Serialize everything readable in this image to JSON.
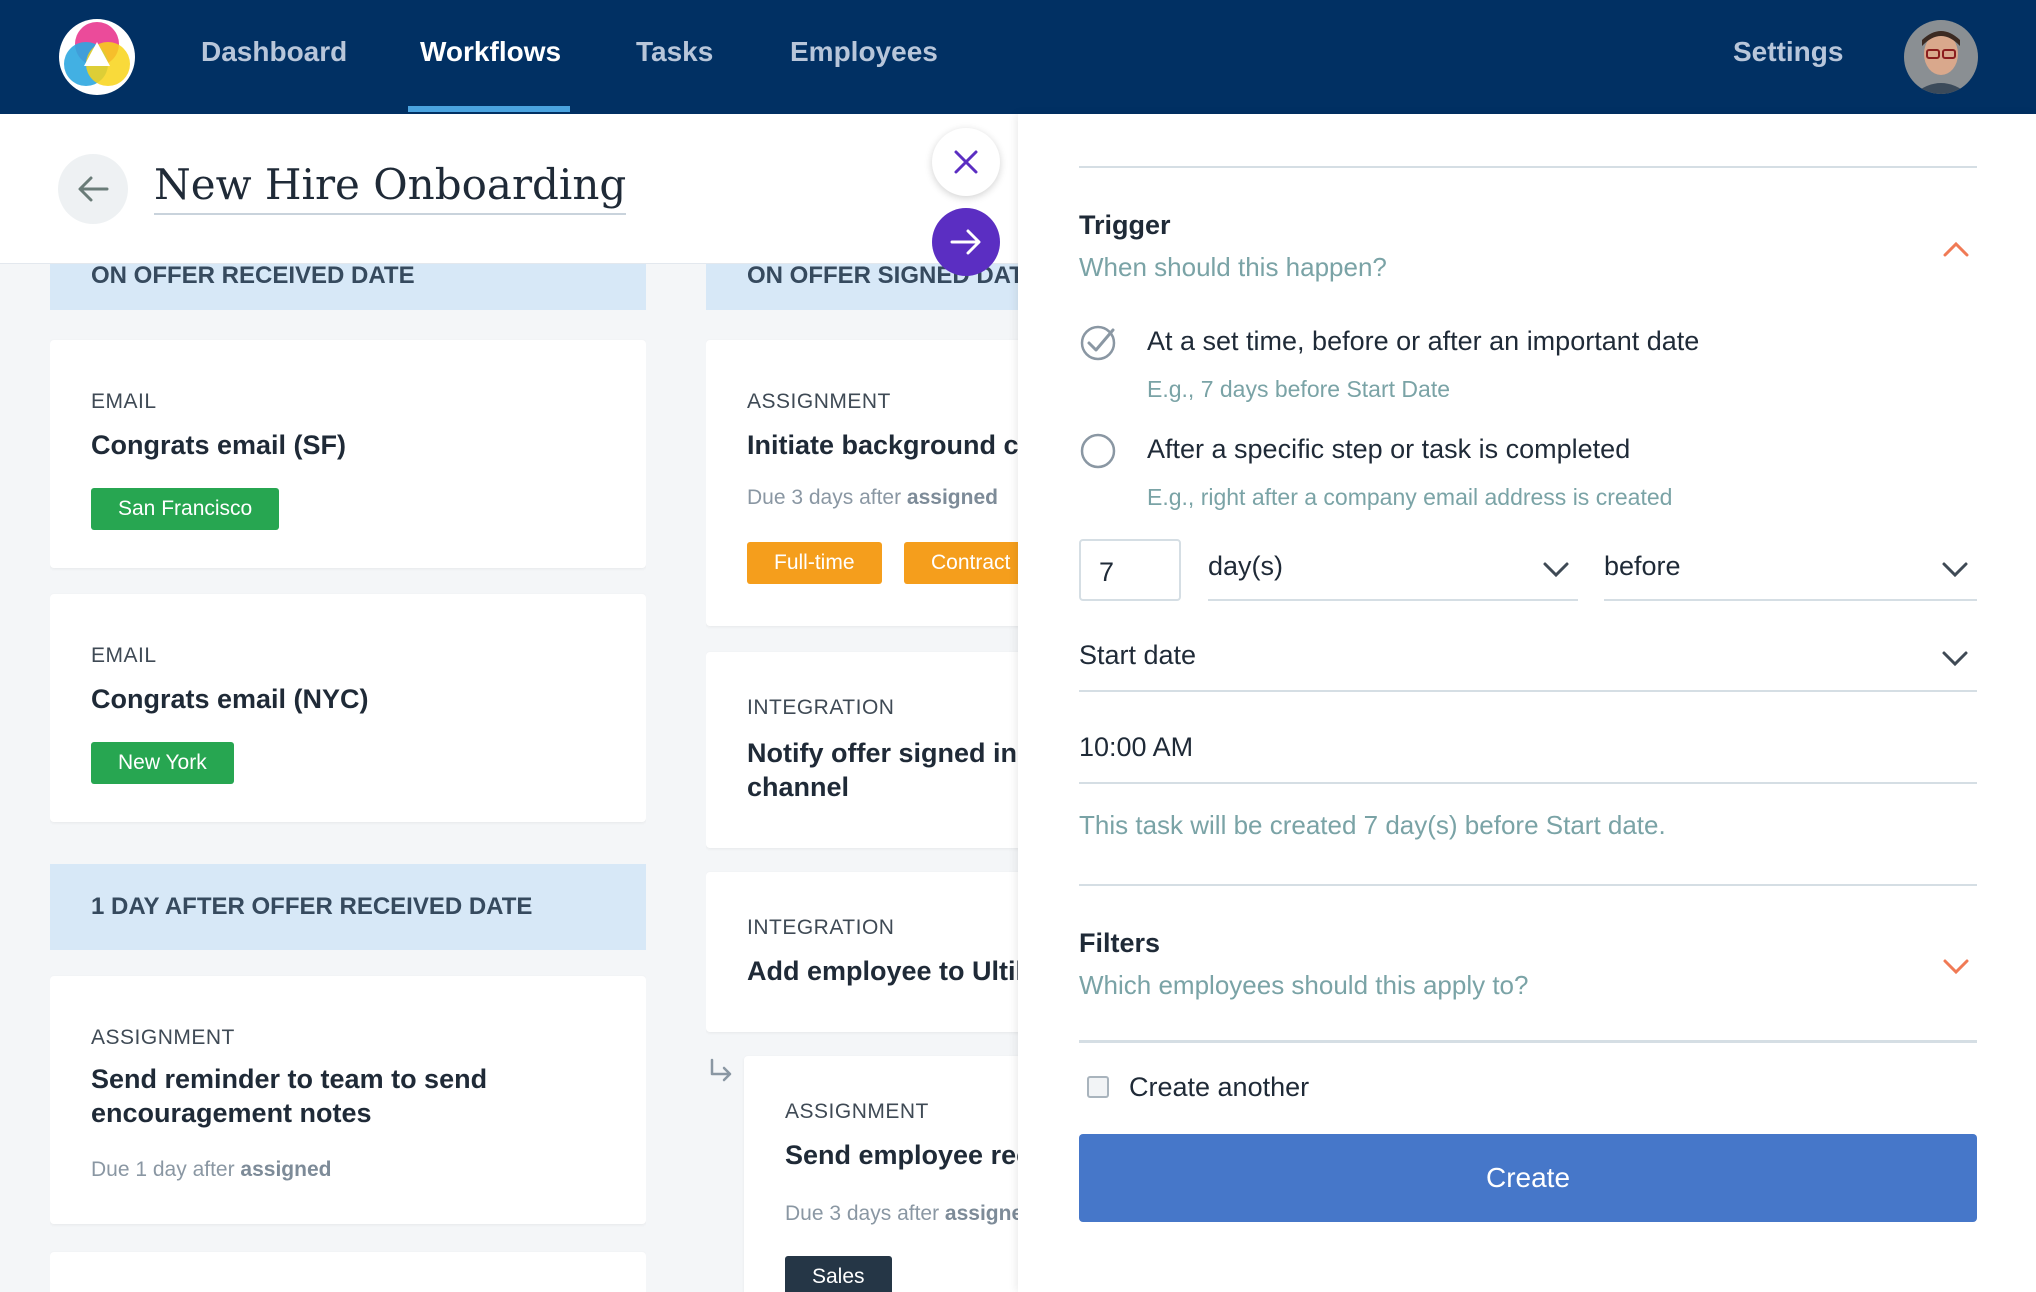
{
  "nav": {
    "links": [
      {
        "label": "Dashboard"
      },
      {
        "label": "Workflows",
        "active": true
      },
      {
        "label": "Tasks"
      },
      {
        "label": "Employees"
      }
    ],
    "settings_label": "Settings",
    "accent": "#013063"
  },
  "page": {
    "title": "New Hire Onboarding"
  },
  "columns": {
    "col1": {
      "header_top": "ON OFFER RECEIVED DATE",
      "cards": [
        {
          "type": "EMAIL",
          "title": "Congrats email (SF)",
          "tag": "San Francisco"
        },
        {
          "type": "EMAIL",
          "title": "Congrats email (NYC)",
          "tag": "New York"
        }
      ],
      "header_mid": "1 DAY AFTER OFFER RECEIVED DATE",
      "card3": {
        "type": "ASSIGNMENT",
        "title_line1": "Send reminder to team to send",
        "title_line2": "encouragement notes",
        "due_prefix": "Due 1 day after ",
        "due_bold": "assigned"
      }
    },
    "col2": {
      "header_top": "ON OFFER SIGNED DATE",
      "card1": {
        "type": "ASSIGNMENT",
        "title": "Initiate background c",
        "due_prefix": "Due 3 days after ",
        "due_bold": "assigned",
        "tags": [
          "Full-time",
          "Contract"
        ]
      },
      "card2": {
        "type": "INTEGRATION",
        "title_line1": "Notify offer signed in",
        "title_line2": "channel"
      },
      "card3": {
        "type": "INTEGRATION",
        "title": "Add employee to Ultil"
      },
      "card4": {
        "type": "ASSIGNMENT",
        "title": "Send employee rec",
        "due_prefix": "Due 3 days after ",
        "due_bold": "assigned",
        "tag": "Sales"
      }
    }
  },
  "panel": {
    "trigger": {
      "title": "Trigger",
      "subtitle": "When should this happen?",
      "options": [
        {
          "label": "At a set time, before or after an important date",
          "hint": "E.g., 7 days before Start Date",
          "selected": true
        },
        {
          "label": "After a specific step or task is completed",
          "hint": "E.g., right after a company email address is created",
          "selected": false
        }
      ],
      "amount": "7",
      "unit": "day(s)",
      "direction": "before",
      "date_field": "Start date",
      "time": "10:00 AM",
      "summary": "This task will be created 7 day(s) before Start date."
    },
    "filters": {
      "title": "Filters",
      "subtitle": "Which employees should this apply to?"
    },
    "create_another_label": "Create another",
    "create_label": "Create",
    "button_color": "#4677c9"
  }
}
